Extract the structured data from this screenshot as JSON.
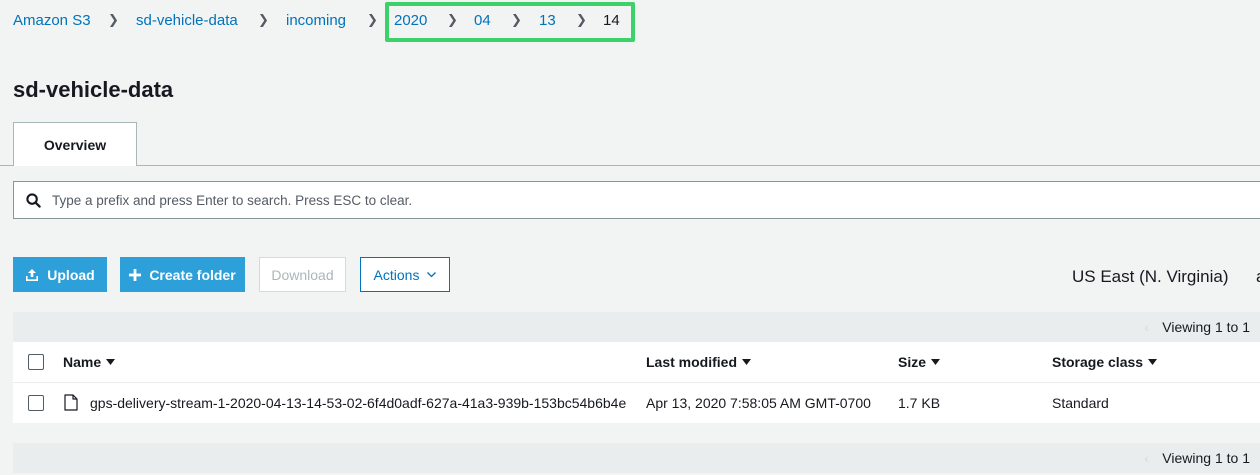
{
  "breadcrumb": {
    "items": [
      {
        "label": "Amazon S3"
      },
      {
        "label": "sd-vehicle-data"
      },
      {
        "label": "incoming"
      },
      {
        "label": "2020"
      },
      {
        "label": "04"
      },
      {
        "label": "13"
      },
      {
        "label": "14"
      }
    ],
    "highlight_color": "#3dd16b"
  },
  "bucket_title": "sd-vehicle-data",
  "tabs": [
    {
      "label": "Overview"
    }
  ],
  "search": {
    "placeholder": "Type a prefix and press Enter to search. Press ESC to clear.",
    "value": ""
  },
  "toolbar": {
    "upload_label": "Upload",
    "upload_icon": "upload-icon",
    "create_folder_label": "Create folder",
    "create_folder_icon": "plus-icon",
    "download_label": "Download",
    "actions_label": "Actions",
    "region": "US East (N. Virginia)",
    "region_extra": "a"
  },
  "table": {
    "viewing_top": "Viewing 1 to 1",
    "viewing_bottom": "Viewing 1 to 1",
    "columns": {
      "name": "Name",
      "last_modified": "Last modified",
      "size": "Size",
      "storage_class": "Storage class"
    },
    "rows": [
      {
        "name": "gps-delivery-stream-1-2020-04-13-14-53-02-6f4d0adf-627a-41a3-939b-153bc54b6b4e",
        "last_modified": "Apr 13, 2020 7:58:05 AM GMT-0700",
        "size": "1.7 KB",
        "storage_class": "Standard"
      }
    ]
  },
  "colors": {
    "primary": "#2d9fd9",
    "link": "#0073bb",
    "background": "#f2f3f3"
  }
}
